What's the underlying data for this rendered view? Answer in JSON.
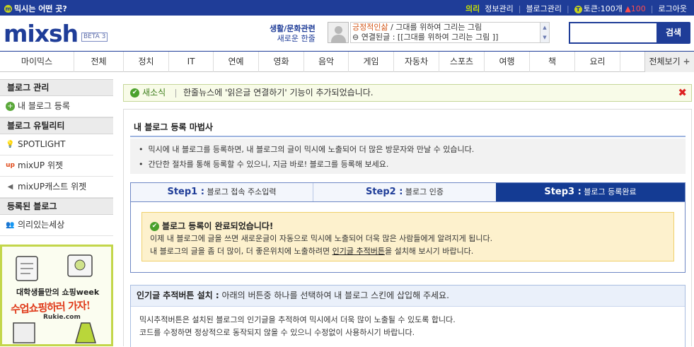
{
  "topbar": {
    "help": "믹시는 어떤 곳?",
    "user": "의리",
    "info": "정보관리",
    "blog": "블로그관리",
    "token": "토큰:100개",
    "token_delta": "▲100",
    "logout": "로그아웃"
  },
  "header": {
    "logo": "mixsh",
    "beta": "BETA 3",
    "category": "생활/문화관련",
    "category_sub": "새로운 한줄",
    "featured_line1_highlight": "긍정적인삶",
    "featured_line1": " / 그대를 위하여 그리는 그림",
    "featured_line2": "연결된글 : [[그대를 위하여 그리는 그림 ]]",
    "search_button": "검색",
    "search_placeholder": ""
  },
  "nav": {
    "tabs": [
      "마이믹스",
      "전체",
      "정치",
      "IT",
      "연예",
      "영화",
      "음악",
      "게임",
      "자동차",
      "스포츠",
      "여행",
      "책",
      "요리"
    ],
    "all": "전체보기"
  },
  "sidebar": {
    "blog_manage": "블로그 관리",
    "register": "내 블로그 등록",
    "utility": "블로그 유틸리티",
    "spotlight": "SPOTLIGHT",
    "mixup_widget": "mixUP 위젯",
    "mixup_cast": "mixUP캐스트 위젯",
    "registered": "등록된 블로그",
    "my_blog": "의리있는세상"
  },
  "banner": {
    "line1": "대학생들만의 쇼핑week",
    "line2": "수업쇼핑하러 가자!",
    "site": "Rukie.com"
  },
  "notice": {
    "label": "새소식",
    "text": "한줄뉴스에 '읽은글 연결하기' 기능이 추가되었습니다."
  },
  "wizard": {
    "title": "내 블로그 등록 마법사",
    "info1": "믹시에 내 블로그를 등록하면, 내 블로그의 글이 믹시에 노출되어 더 많은 방문자와 만날 수 있습니다.",
    "info2": "간단한 절차를 통해 등록할 수 있으니, 지금 바로! 블로그를 등록해 보세요.",
    "steps": [
      {
        "num": "Step1 :",
        "label": " 블로그 접속 주소입력"
      },
      {
        "num": "Step2 :",
        "label": " 블로그 인증"
      },
      {
        "num": "Step3 :",
        "label": " 블로그 등록완료"
      }
    ],
    "done_title": "블로그 등록이 완료되었습니다!",
    "done_line1": "이제 내 블로그에 글을 쓰면 새로운글이 자동으로 믹시에 노출되어 더욱 많은 사람들에게 알려지게 됩니다.",
    "done_line2a": "내 블로그의 글을 좀 더 많이, 더 좋은위치에 노출하려면 ",
    "done_line2_link": "인기글 추적버튼",
    "done_line2b": "을 설치해 보시기 바랍니다.",
    "install_title": "인기글 추적버튼 설치 :",
    "install_desc": " 아래의 버튼중 하나를 선택하여 내 블로그 스킨에 삽입해 주세요.",
    "install_line1": "믹시추적버튼은 설치된 블로그의 인기글을 추적하여 믹시에서 더욱 많이 노출될 수 있도록 합니다.",
    "install_line2": "코드를 수정하면 정상적으로 동작되지 않을 수 있으니 수정없이 사용하시기 바랍니다."
  }
}
